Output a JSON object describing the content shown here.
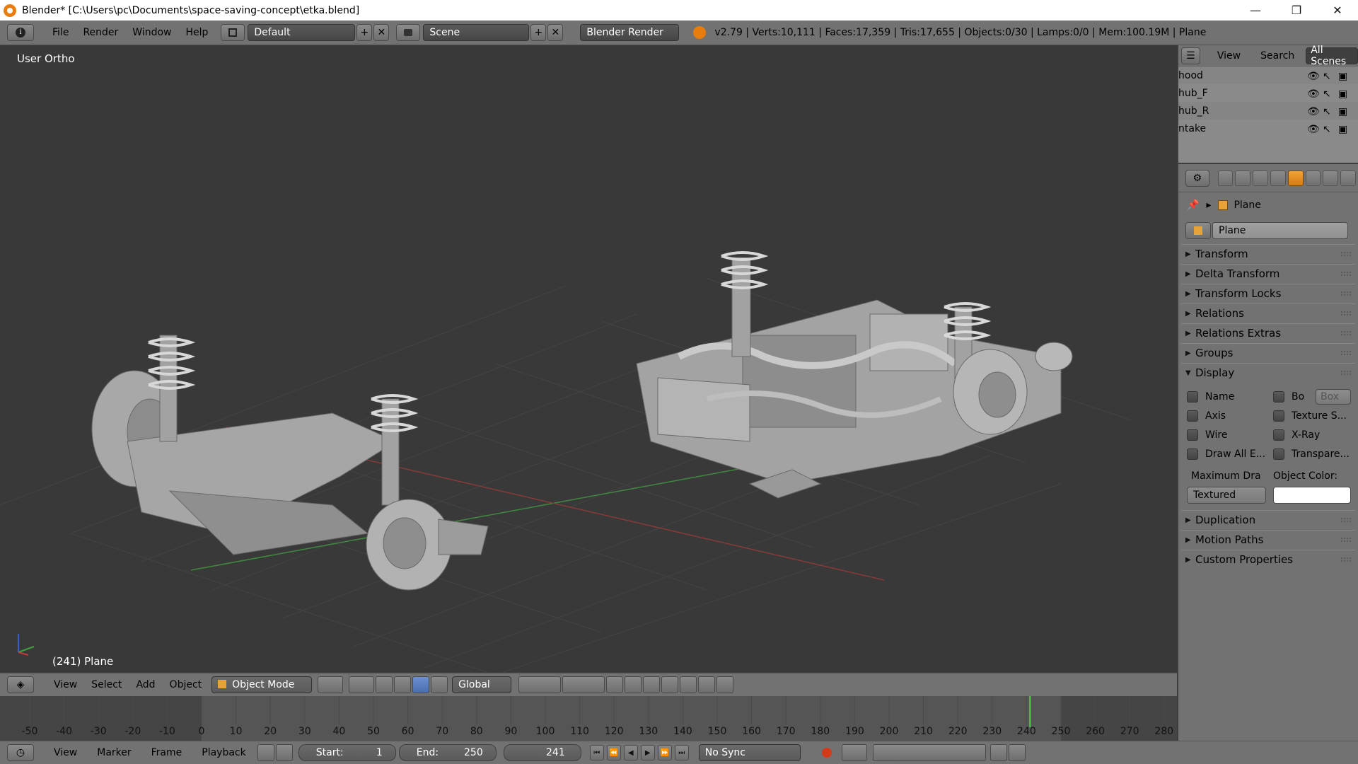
{
  "window": {
    "title": "Blender* [C:\\Users\\pc\\Documents\\space-saving-concept\\etka.blend]",
    "minimize": "—",
    "maximize": "❐",
    "close": "✕"
  },
  "infobar": {
    "menus": [
      "File",
      "Render",
      "Window",
      "Help"
    ],
    "layout": "Default",
    "scene": "Scene",
    "engine": "Blender Render",
    "stats": "v2.79 | Verts:10,111 | Faces:17,359 | Tris:17,655 | Objects:0/30 | Lamps:0/0 | Mem:100.19M | Plane"
  },
  "viewport": {
    "view_label": "User Ortho",
    "object_label": "(241) Plane"
  },
  "outliner": {
    "menus": [
      "View",
      "Search"
    ],
    "filter": "All Scenes",
    "rows": [
      "hood",
      "hub_F",
      "hub_R",
      "ntake"
    ]
  },
  "properties": {
    "breadcrumb": "Plane",
    "object_name": "Plane",
    "panels_top": [
      "Transform",
      "Delta Transform",
      "Transform Locks",
      "Relations",
      "Relations Extras",
      "Groups"
    ],
    "display_panel": "Display",
    "display": {
      "left": [
        "Name",
        "Axis",
        "Wire",
        "Draw All E..."
      ],
      "right": [
        "Bo",
        "Texture S...",
        "X-Ray",
        "Transpare..."
      ],
      "bounds_type": "Box",
      "max_draw_label": "Maximum Dra",
      "max_draw_value": "Textured",
      "object_color_label": "Object Color:",
      "object_color": "#ffffff"
    },
    "panels_bottom": [
      "Duplication",
      "Motion Paths",
      "Custom Properties"
    ]
  },
  "view_header": {
    "menus": [
      "View",
      "Select",
      "Add",
      "Object"
    ],
    "mode": "Object Mode",
    "orientation": "Global"
  },
  "timeline": {
    "ticks": [
      "-50",
      "-40",
      "-30",
      "-20",
      "-10",
      "0",
      "10",
      "20",
      "30",
      "40",
      "50",
      "60",
      "70",
      "80",
      "90",
      "100",
      "110",
      "120",
      "130",
      "140",
      "150",
      "160",
      "170",
      "180",
      "190",
      "200",
      "210",
      "220",
      "230",
      "240",
      "250",
      "260",
      "270",
      "280"
    ],
    "current_frame": 241
  },
  "timeline_header": {
    "menus": [
      "View",
      "Marker",
      "Frame",
      "Playback"
    ],
    "start_label": "Start:",
    "start": "1",
    "end_label": "End:",
    "end": "250",
    "current": "241",
    "sync": "No Sync"
  }
}
